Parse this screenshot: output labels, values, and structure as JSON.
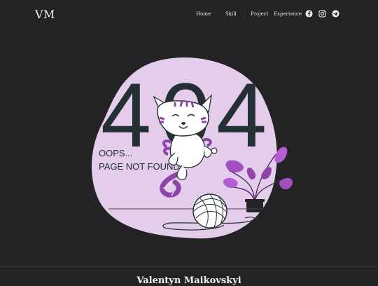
{
  "brand": {
    "logo": "VM"
  },
  "nav": {
    "items": [
      {
        "label": "Home"
      },
      {
        "label": "Skill"
      },
      {
        "label": "Project"
      },
      {
        "label": "Experience"
      }
    ],
    "social": [
      {
        "icon": "facebook-icon"
      },
      {
        "icon": "instagram-icon"
      },
      {
        "icon": "telegram-icon"
      }
    ]
  },
  "error": {
    "code_digits": [
      "4",
      "0",
      "4"
    ],
    "line1": "OOPS...",
    "line2": "PAGE NOT FOUND"
  },
  "footer": {
    "name": "Valentyn Maikovskyi"
  },
  "colors": {
    "background": "#232325",
    "blob": "#e3cdeb",
    "digits": "#253035",
    "accent_purple": "#a24fc1",
    "cat_stripes": "#8f44a8"
  }
}
